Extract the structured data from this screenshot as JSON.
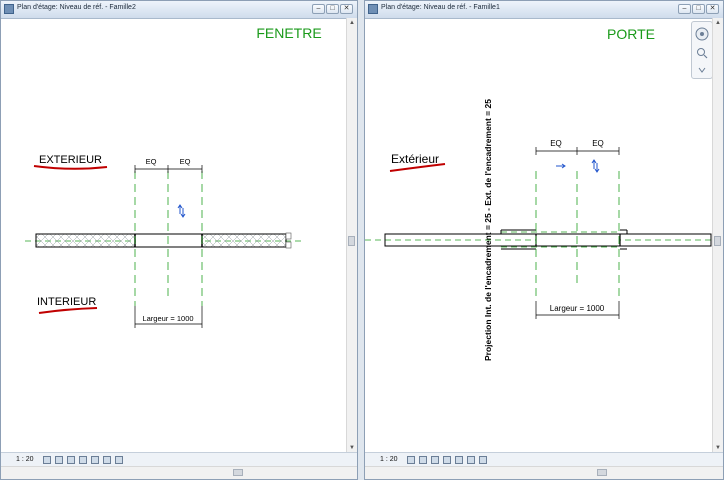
{
  "left_window": {
    "title": "Plan d'étage: Niveau de réf. - Famille2",
    "heading": "FENETRE",
    "label_exterior": "EXTERIEUR",
    "label_interior": "INTERIEUR",
    "dim_eq_1": "EQ",
    "dim_eq_2": "EQ",
    "dim_width": "Largeur = 1000",
    "scale": "1 : 20"
  },
  "right_window": {
    "title": "Plan d'étage: Niveau de réf. - Famille1",
    "heading": "PORTE",
    "label_exterior": "Extérieur",
    "dim_eq_1": "EQ",
    "dim_eq_2": "EQ",
    "dim_width": "Largeur = 1000",
    "vertical_label": "Projection Int. de l'encadrement = 25 - Ext. de l'encadrement = 25",
    "scale": "1 : 20"
  },
  "window_controls": {
    "minimize": "–",
    "maximize": "□",
    "close": "✕"
  },
  "colors": {
    "heading": "#1a9a1a",
    "underline": "#c00000",
    "reference_line": "#22a022",
    "flip_arrow": "#2255cc"
  },
  "icons": [
    "app-icon",
    "minimize-icon",
    "maximize-icon",
    "close-icon",
    "flip-arrow-icon",
    "steering-wheel-icon",
    "zoom-icon",
    "view-control-icon"
  ]
}
